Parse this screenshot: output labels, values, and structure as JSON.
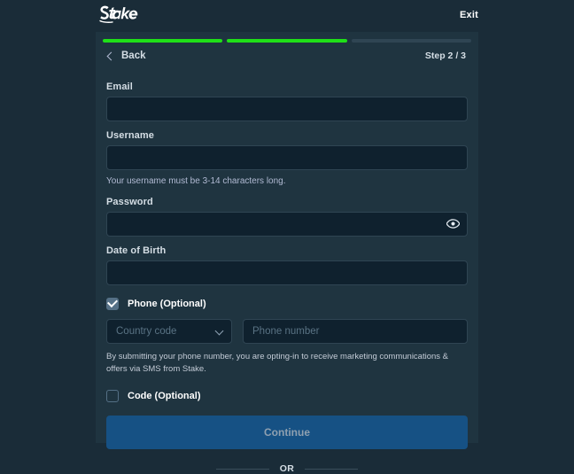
{
  "brand": {
    "logo_text": "Stake"
  },
  "header": {
    "exit_label": "Exit"
  },
  "progress": {
    "segments": [
      "done",
      "done",
      "todo"
    ],
    "done_color": "#1FE018",
    "todo_color": "#2F4553"
  },
  "nav": {
    "back_label": "Back",
    "step_label": "Step 2 / 3"
  },
  "form": {
    "email": {
      "label": "Email",
      "value": "",
      "placeholder": ""
    },
    "username": {
      "label": "Username",
      "value": "",
      "placeholder": "",
      "hint": "Your username must be 3-14 characters long."
    },
    "password": {
      "label": "Password",
      "value": "",
      "placeholder": "",
      "reveal_icon": "eye-icon"
    },
    "date_of_birth": {
      "label": "Date of Birth",
      "value": "",
      "placeholder": ""
    },
    "phone": {
      "checkbox_label": "Phone (Optional)",
      "checked": true,
      "country_code_placeholder": "Country code",
      "country_code_value": "",
      "phone_number_placeholder": "Phone number",
      "phone_number_value": "",
      "sms_note": "By submitting your phone number, you are opting-in to receive marketing communications & offers via SMS from Stake."
    },
    "code": {
      "checkbox_label": "Code (Optional)",
      "checked": false
    }
  },
  "actions": {
    "continue_label": "Continue",
    "continue_color": "#165184",
    "or_label": "OR"
  },
  "theme": {
    "page_background": "#1A2C38",
    "panel_background": "#1F3440",
    "input_background": "#0F212E",
    "input_border": "#2F4553",
    "text_primary": "#FFFFFF",
    "text_secondary": "#D5DEE5",
    "text_muted": "#B1BAD3"
  }
}
